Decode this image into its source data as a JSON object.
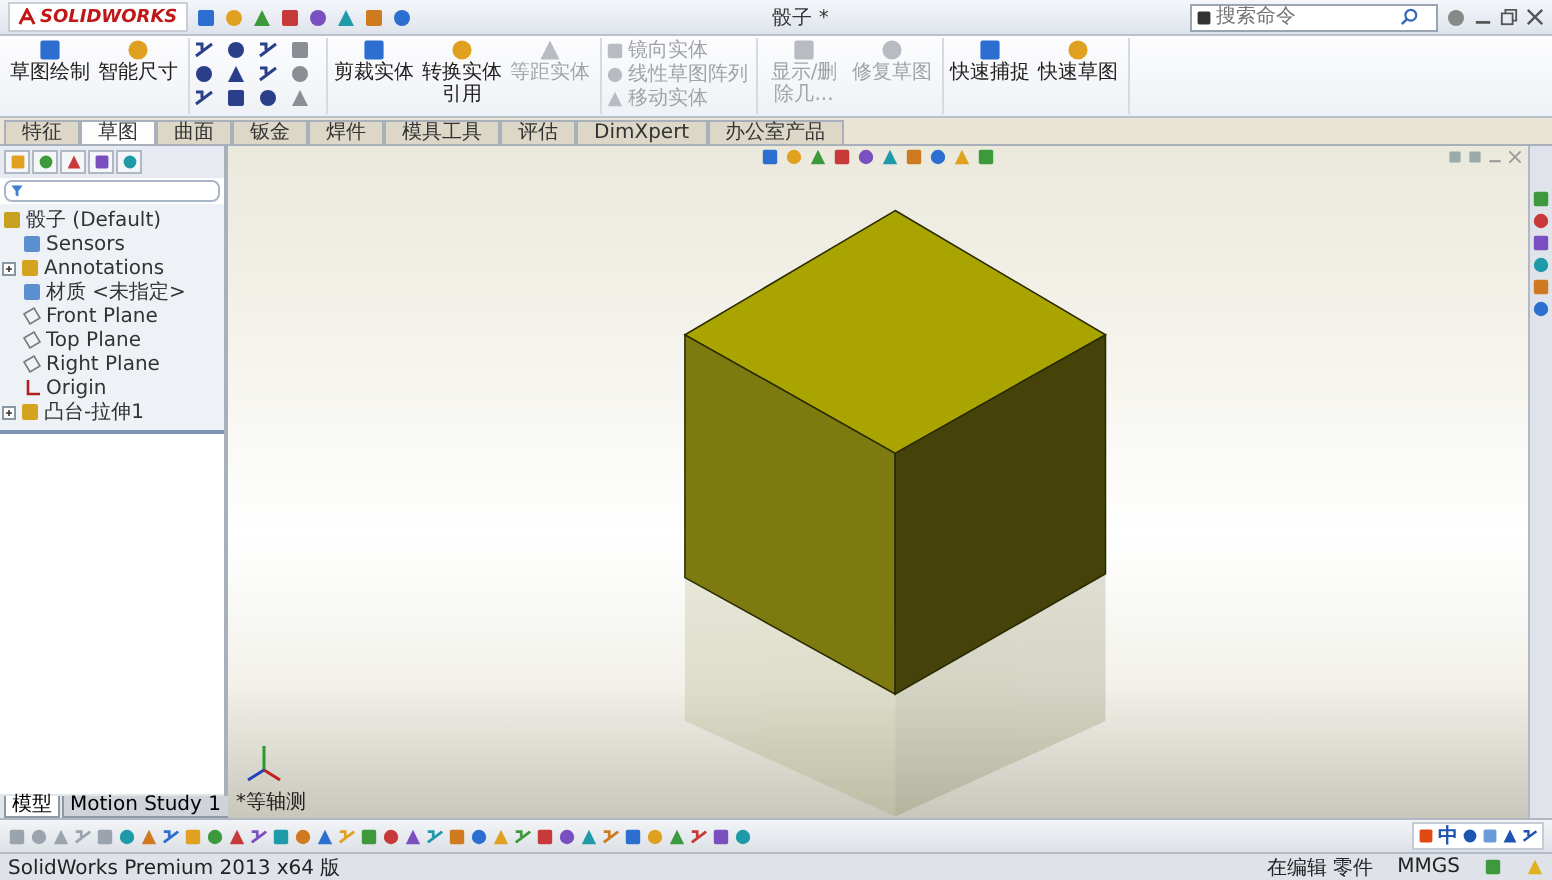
{
  "title_bar": {
    "app_name": "SOLIDWORKS",
    "document_title": "骰子 *",
    "search": {
      "placeholder": "搜索命令"
    }
  },
  "ribbon": {
    "groups": [
      {
        "kind": "large_buttons",
        "buttons": [
          {
            "label": "草图绘制",
            "disabled": false
          },
          {
            "label": "智能尺寸",
            "disabled": false
          }
        ]
      },
      {
        "kind": "tool_grid"
      },
      {
        "kind": "large_buttons",
        "buttons": [
          {
            "label": "剪裁实体",
            "disabled": false
          },
          {
            "label": "转换实体引用",
            "disabled": false
          },
          {
            "label": "等距实体",
            "disabled": true
          }
        ]
      },
      {
        "kind": "small_buttons",
        "buttons": [
          {
            "label": "镜向实体",
            "disabled": true
          },
          {
            "label": "线性草图阵列",
            "disabled": true
          },
          {
            "label": "移动实体",
            "disabled": true
          }
        ]
      },
      {
        "kind": "large_buttons",
        "buttons": [
          {
            "label": "显示/删除几...",
            "disabled": true
          },
          {
            "label": "修复草图",
            "disabled": true
          }
        ]
      },
      {
        "kind": "large_buttons",
        "buttons": [
          {
            "label": "快速捕捉",
            "disabled": false
          },
          {
            "label": "快速草图",
            "disabled": false
          }
        ]
      }
    ]
  },
  "command_tabs": [
    {
      "label": "特征",
      "selected": false
    },
    {
      "label": "草图",
      "selected": true
    },
    {
      "label": "曲面",
      "selected": false
    },
    {
      "label": "钣金",
      "selected": false
    },
    {
      "label": "焊件",
      "selected": false
    },
    {
      "label": "模具工具",
      "selected": false
    },
    {
      "label": "评估",
      "selected": false
    },
    {
      "label": "DimXpert",
      "selected": false
    },
    {
      "label": "办公室产品",
      "selected": false
    }
  ],
  "feature_tree": {
    "root": "骰子 (Default)",
    "children": [
      {
        "label": "Sensors",
        "kind": "plain"
      },
      {
        "label": "Annotations",
        "kind": "collapsible"
      },
      {
        "label": "材质 <未指定>",
        "kind": "plain"
      },
      {
        "label": "Front Plane",
        "kind": "plane"
      },
      {
        "label": "Top Plane",
        "kind": "plane"
      },
      {
        "label": "Right Plane",
        "kind": "plane"
      },
      {
        "label": "Origin",
        "kind": "origin"
      },
      {
        "label": "凸台-拉伸1",
        "kind": "collapsible"
      }
    ]
  },
  "bottom_tabs": [
    {
      "label": "模型",
      "selected": true
    },
    {
      "label": "Motion Study 1",
      "selected": false
    }
  ],
  "viewport": {
    "view_label": "*等轴测"
  },
  "ime_bar": {
    "language": "中"
  },
  "status_bar": {
    "product": "SolidWorks Premium 2013 x64 版",
    "mode": "在编辑 零件",
    "units": "MMGS"
  }
}
